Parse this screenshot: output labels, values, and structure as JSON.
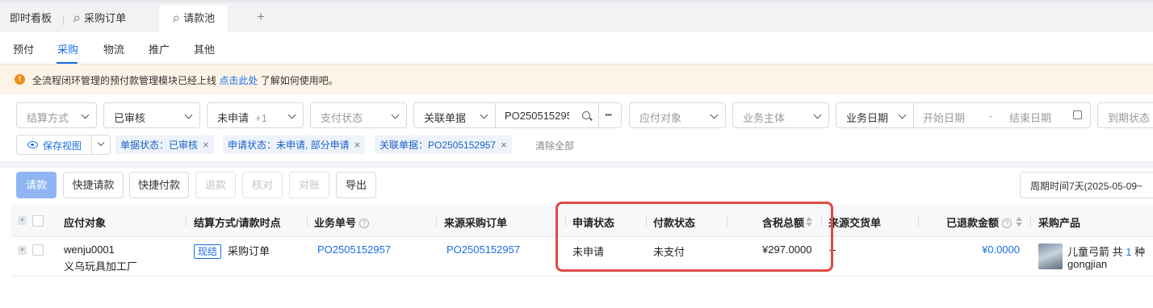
{
  "tabs": [
    {
      "label": "即时看板",
      "pinned": false,
      "active": false
    },
    {
      "label": "采购订单",
      "pinned": true,
      "active": false
    },
    {
      "label": "请款池",
      "pinned": true,
      "active": true
    }
  ],
  "add_tab_label": "+",
  "subnav": [
    "预付",
    "采购",
    "物流",
    "推广",
    "其他"
  ],
  "subnav_active": "采购",
  "notice": {
    "icon": "warning-icon",
    "text_before": "全流程闭环管理的预付款管理模块已经上线",
    "link": "点击此处",
    "text_after": "了解如何使用吧。"
  },
  "filters": {
    "settlement": "结算方式",
    "doc_status": "已审核",
    "apply_status": "未申请",
    "apply_status_more": "+1",
    "pay_status": "支付状态",
    "related_doc_type": "关联单据",
    "related_doc_value": "PO2505152957",
    "payee": "应付对象",
    "entity": "业务主体",
    "date_type": "业务日期",
    "start_date_placeholder": "开始日期",
    "date_sep": "-",
    "end_date_placeholder": "结束日期",
    "due_date": "到期状态",
    "more": "···"
  },
  "save_view_label": "保存视图",
  "chips": [
    "单据状态：已审核",
    "申请状态：未申请, 部分申请",
    "关联单据：PO2505152957"
  ],
  "chip_close": "×",
  "clear_all": "清除全部",
  "toolbar": {
    "buttons": [
      {
        "label": "请款",
        "state": "primary"
      },
      {
        "label": "快捷请款",
        "state": "normal"
      },
      {
        "label": "快捷付款",
        "state": "normal"
      },
      {
        "label": "退款",
        "state": "disabled"
      },
      {
        "label": "核对",
        "state": "disabled"
      },
      {
        "label": "对账",
        "state": "disabled"
      },
      {
        "label": "导出",
        "state": "normal"
      }
    ],
    "period": "周期时间7天(2025-05-09~"
  },
  "table": {
    "headers": {
      "payee": "应付对象",
      "settlement": "结算方式/请款时点",
      "biz_no": "业务单号",
      "source_po": "来源采购订单",
      "apply_status": "申请状态",
      "pay_status": "付款状态",
      "total_tax": "含税总额",
      "source_delivery": "来源交货单",
      "refunded": "已退款金额",
      "product": "采购产品"
    },
    "help_mark": "?",
    "rows": [
      {
        "payee_code": "wenju0001",
        "payee_name": "义乌玩具加工厂",
        "settlement_tag": "现结",
        "settlement_point": "采购订单",
        "biz_no": "PO2505152957",
        "source_po": "PO2505152957",
        "apply_status": "未申请",
        "pay_status": "未支付",
        "total_tax": "¥297.0000",
        "source_delivery": "--",
        "refunded": "¥0.0000",
        "product_name": "儿童弓箭 共",
        "product_count": "1",
        "product_unit": "种",
        "product_sku": "gongjian"
      }
    ]
  }
}
